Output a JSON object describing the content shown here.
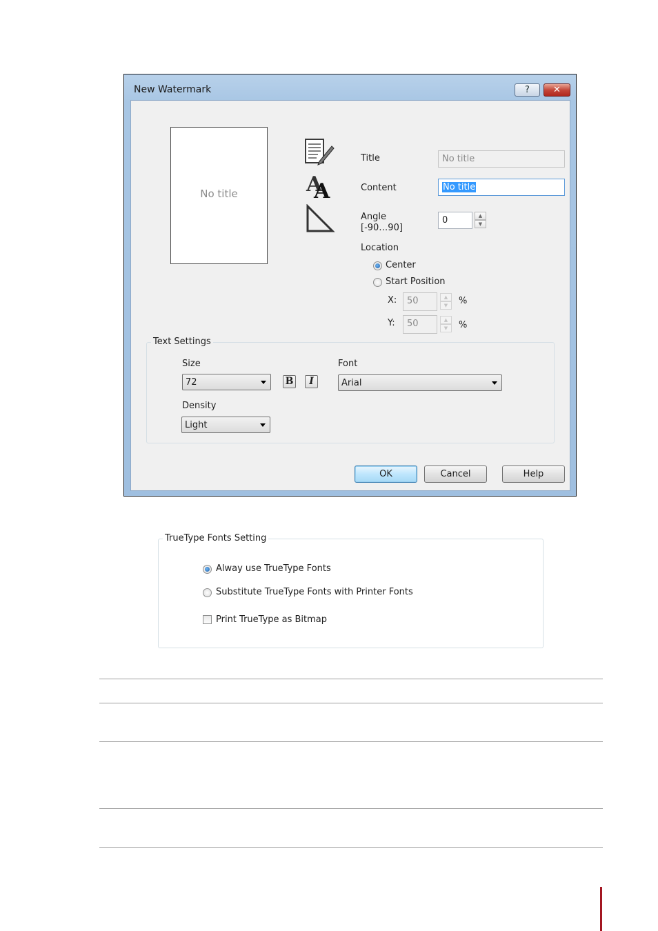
{
  "dialog": {
    "title": "New Watermark",
    "help_glyph": "?",
    "close_glyph": "✕",
    "preview_text": "No title",
    "fields": {
      "title_label": "Title",
      "title_value": "No title",
      "content_label": "Content",
      "content_value": "No title",
      "angle_label_line1": "Angle",
      "angle_label_line2": "[-90…90]",
      "angle_value": "0"
    },
    "location": {
      "label": "Location",
      "options": [
        "Center",
        "Start Position"
      ],
      "selected": "Center",
      "x_label": "X:",
      "x_value": "50",
      "y_label": "Y:",
      "y_value": "50",
      "unit": "%"
    },
    "text_settings": {
      "group_label": "Text Settings",
      "size_label": "Size",
      "size_value": "72",
      "bold_glyph": "B",
      "italic_glyph": "I",
      "font_label": "Font",
      "font_value": "Arial",
      "density_label": "Density",
      "density_value": "Light"
    },
    "buttons": {
      "ok": "OK",
      "cancel": "Cancel",
      "help": "Help"
    }
  },
  "truetype": {
    "group_label": "TrueType Fonts Setting",
    "options": [
      "Alway use TrueType Fonts",
      "Substitute TrueType Fonts with Printer Fonts"
    ],
    "selected": "Alway use TrueType Fonts",
    "bitmap_label": "Print TrueType as Bitmap",
    "bitmap_checked": false
  },
  "icons": [
    "document-edit-icon",
    "font-icon",
    "angle-triangle-icon",
    "spin-up-icon",
    "spin-down-icon",
    "dropdown-arrow-icon"
  ],
  "colors": {
    "title_bar": "#a8c6e4",
    "close_button": "#c4483a",
    "selection": "#3399ff",
    "accent_bar": "#a31621"
  }
}
